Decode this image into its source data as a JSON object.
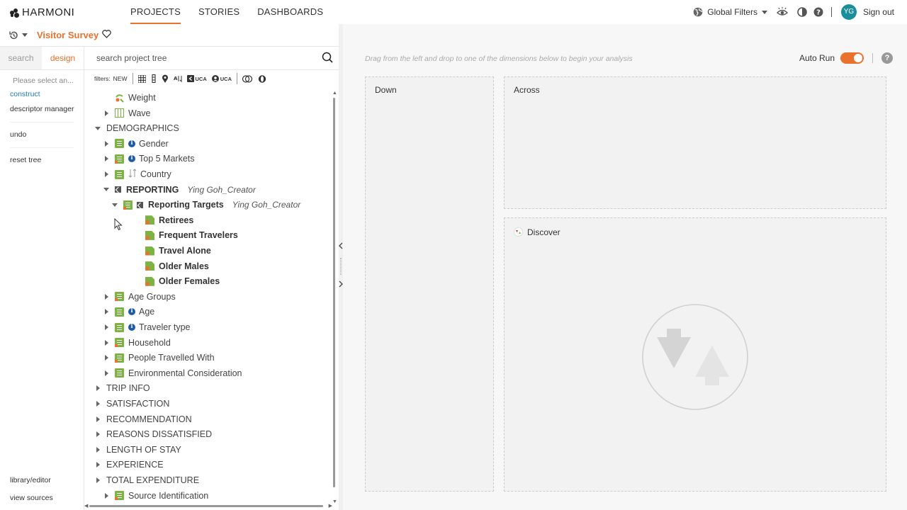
{
  "brand": {
    "name": "HARMONI"
  },
  "nav": [
    {
      "label": "PROJECTS",
      "active": true
    },
    {
      "label": "STORIES",
      "active": false
    },
    {
      "label": "DASHBOARDS",
      "active": false
    }
  ],
  "topright": {
    "global_filters": "Global Filters",
    "avatar": "YG",
    "sign_out": "Sign out"
  },
  "project": {
    "name": "Visitor Survey"
  },
  "left": {
    "tabs": [
      {
        "label": "search",
        "active": false
      },
      {
        "label": "design",
        "active": true
      }
    ],
    "placeholder": "Please select an...",
    "items": [
      "construct",
      "descriptor manager",
      "undo",
      "reset tree"
    ],
    "bottom": [
      "library/editor",
      "view sources"
    ]
  },
  "tree_panel": {
    "search_placeholder": "search project tree",
    "filters_label": "filters:",
    "filter_new": "NEW",
    "filter_uca_1": "UCA",
    "filter_uca_2": "UCA"
  },
  "tree": [
    {
      "label": "Weight",
      "icon": "weight-icon",
      "depth": 1,
      "caret": "none"
    },
    {
      "label": "Wave",
      "icon": "grid",
      "depth": 1,
      "caret": "right"
    },
    {
      "label": "DEMOGRAPHICS",
      "icon": "none",
      "depth": 0,
      "caret": "down"
    },
    {
      "label": "Gender",
      "icon": "list",
      "info": true,
      "depth": 2,
      "caret": "right"
    },
    {
      "label": "Top 5 Markets",
      "icon": "list-orange",
      "info": true,
      "depth": 2,
      "caret": "right"
    },
    {
      "label": "Country",
      "icon": "list",
      "sort": true,
      "depth": 2,
      "caret": "right"
    },
    {
      "label": "REPORTING",
      "icon": "square",
      "depth": 2,
      "caret": "down",
      "bold": true,
      "owner": "Ying Goh_Creator"
    },
    {
      "label": "Reporting Targets",
      "icon": "list-orange",
      "square": true,
      "depth": 3,
      "caret": "down",
      "bold": true,
      "owner": "Ying Goh_Creator"
    },
    {
      "label": "Retirees",
      "icon": "target",
      "depth": 4,
      "caret": "none",
      "bold": true
    },
    {
      "label": "Frequent Travelers",
      "icon": "target",
      "depth": 4,
      "caret": "none",
      "bold": true
    },
    {
      "label": "Travel Alone",
      "icon": "target",
      "depth": 4,
      "caret": "none",
      "bold": true
    },
    {
      "label": "Older Males",
      "icon": "target",
      "depth": 4,
      "caret": "none",
      "bold": true
    },
    {
      "label": "Older Females",
      "icon": "target",
      "depth": 4,
      "caret": "none",
      "bold": true
    },
    {
      "label": "Age Groups",
      "icon": "list-orange",
      "depth": 2,
      "caret": "right"
    },
    {
      "label": "Age",
      "icon": "list",
      "info": true,
      "depth": 2,
      "caret": "right"
    },
    {
      "label": "Traveler type",
      "icon": "list",
      "info": true,
      "depth": 2,
      "caret": "right"
    },
    {
      "label": "Household",
      "icon": "list-orange",
      "depth": 2,
      "caret": "right"
    },
    {
      "label": "People Travelled With",
      "icon": "list-orange",
      "depth": 2,
      "caret": "right"
    },
    {
      "label": "Environmental Consideration",
      "icon": "list",
      "depth": 2,
      "caret": "right"
    },
    {
      "label": "TRIP INFO",
      "icon": "none",
      "depth": 0,
      "caret": "right"
    },
    {
      "label": "SATISFACTION",
      "icon": "none",
      "depth": 0,
      "caret": "right"
    },
    {
      "label": "RECOMMENDATION",
      "icon": "none",
      "depth": 0,
      "caret": "right"
    },
    {
      "label": "REASONS DISSATISFIED",
      "icon": "none",
      "depth": 0,
      "caret": "right"
    },
    {
      "label": "LENGTH OF STAY",
      "icon": "none",
      "depth": 0,
      "caret": "right"
    },
    {
      "label": "EXPERIENCE",
      "icon": "none",
      "depth": 0,
      "caret": "right"
    },
    {
      "label": "TOTAL EXPENDITURE",
      "icon": "none",
      "depth": 0,
      "caret": "right"
    },
    {
      "label": "Source Identification",
      "icon": "list-orange",
      "depth": 1,
      "caret": "right"
    }
  ],
  "canvas": {
    "hint": "Drag from the left and drop to one of the dimensions below to begin your analysis",
    "auto_run": "Auto Run",
    "down": "Down",
    "across": "Across",
    "discover": "Discover"
  },
  "colors": {
    "accent": "#e9722e",
    "tree_green": "#7cb342",
    "info_blue": "#1f5aa8",
    "avatar": "#1a8f9b"
  }
}
